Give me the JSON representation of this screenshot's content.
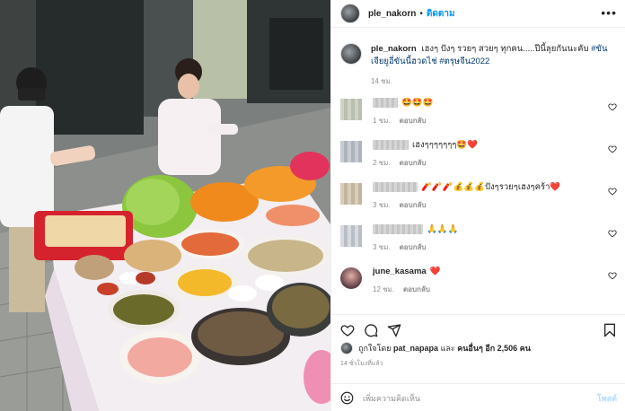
{
  "header": {
    "username": "ple_nakorn",
    "dot": "•",
    "follow_label": "ติดตาม",
    "more_icon": "more-horizontal-icon"
  },
  "caption": {
    "username": "ple_nakorn",
    "text": "เฮงๆ ปังๆ รวยๆ สวยๆ ทุกคน.....ปีนี้ลุยกันนะคับ",
    "hashtags": [
      "#ขันเจียยูอี่ขันนี้ฮวดไช่",
      "#ตรุษจีน2022"
    ],
    "time": "14 ชม."
  },
  "comments": [
    {
      "name": "",
      "name_blurred": true,
      "name_width": 28,
      "text": "🤩🤩🤩",
      "time": "1 ชม.",
      "reply_label": "ตอบกลับ",
      "avatar": "blur1"
    },
    {
      "name": "",
      "name_blurred": true,
      "name_width": 40,
      "text": "เฮงๆๆๆๆๆๆๆ🤩❤️",
      "time": "2 ชม.",
      "reply_label": "ตอบกลับ",
      "avatar": "blur2"
    },
    {
      "name": "",
      "name_blurred": true,
      "name_width": 50,
      "text": "🧨🧨🧨💰💰💰ปังๆรวยๆเฮงๆคร้า❤️",
      "time": "3 ชม.",
      "reply_label": "ตอบกลับ",
      "avatar": "blur3"
    },
    {
      "name": "",
      "name_blurred": true,
      "name_width": 56,
      "text": "🙏🙏🙏",
      "time": "3 ชม.",
      "reply_label": "ตอบกลับ",
      "avatar": "blur4"
    },
    {
      "name": "june_kasama",
      "name_blurred": false,
      "name_width": 0,
      "text": "❤️",
      "time": "12 ชม.",
      "reply_label": "ตอบกลับ",
      "avatar": "june"
    }
  ],
  "actions": {
    "icons": [
      "heart-icon",
      "comment-icon",
      "share-icon",
      "bookmark-icon"
    ]
  },
  "likes": {
    "prefix": "ถูกใจโดย",
    "liker": "pat_napapa",
    "and": "และ",
    "others": "คนอื่นๆ อีก 2,506 คน"
  },
  "post_time": "14 ชั่วโมงที่แล้ว",
  "add_comment": {
    "placeholder": "เพิ่มความคิดเห็น",
    "post_label": "โพสต์",
    "emoji_icon": "smiley-icon"
  },
  "colors": {
    "link": "#0095f6",
    "muted": "#8e8e8e",
    "heart": "#ed4956",
    "border": "#efefef"
  }
}
